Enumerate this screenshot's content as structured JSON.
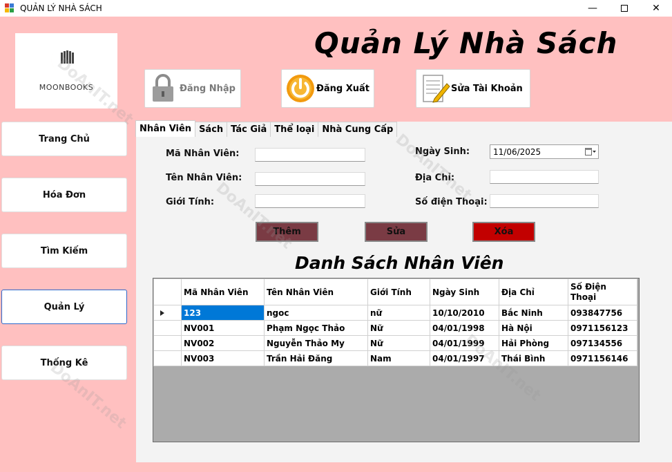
{
  "window": {
    "title": "QUẢN LÝ NHÀ SÁCH"
  },
  "header": {
    "title": "Quản Lý Nhà Sách"
  },
  "logo": {
    "text": "MOONBOOKS"
  },
  "top_buttons": {
    "login": "Đăng Nhập",
    "logout": "Đăng Xuất",
    "edit_account": "Sửa Tài Khoản"
  },
  "sidebar": {
    "items": [
      {
        "label": "Trang Chủ"
      },
      {
        "label": "Hóa Đơn"
      },
      {
        "label": "Tìm Kiếm"
      },
      {
        "label": "Quản Lý"
      },
      {
        "label": "Thống Kê"
      }
    ]
  },
  "tabs": [
    {
      "label": "Nhân Viên"
    },
    {
      "label": "Sách"
    },
    {
      "label": "Tác Giả"
    },
    {
      "label": "Thể loại"
    },
    {
      "label": "Nhà Cung Cấp"
    }
  ],
  "form": {
    "employee_id_label": "Mã Nhân Viên:",
    "employee_name_label": "Tên Nhân Viên:",
    "gender_label": "Giới Tính:",
    "birth_date_label": "Ngày Sinh:",
    "address_label": "Địa Chỉ:",
    "phone_label": "Số điện Thoại:",
    "birth_date_value": "11/06/2025"
  },
  "actions": {
    "add": "Thêm",
    "edit": "Sửa",
    "delete": "Xóa"
  },
  "list": {
    "title": "Danh Sách Nhân Viên",
    "columns": [
      "Mã Nhân Viên",
      "Tên Nhân Viên",
      "Giới Tính",
      "Ngày Sinh",
      "Địa Chỉ",
      "Số Điện Thoại"
    ],
    "rows": [
      [
        "123",
        "ngoc",
        "nữ",
        "10/10/2010",
        "Bắc Ninh",
        "093847756"
      ],
      [
        "NV001",
        "Phạm Ngọc Thảo",
        "Nữ",
        "04/01/1998",
        "Hà Nội",
        "0971156123"
      ],
      [
        "NV002",
        "Nguyễn Thảo My",
        "Nữ",
        "04/01/1999",
        "Hải Phòng",
        "097134556"
      ],
      [
        "NV003",
        "Trần Hải Đăng",
        "Nam",
        "04/01/1997",
        "Thái Bình",
        "0971156146"
      ]
    ]
  },
  "watermark": {
    "text": "DoAnIT.net"
  },
  "colors": {
    "background": "#ffc0c0",
    "add_button": "#7a3b44",
    "delete_button": "#c20000",
    "selection": "#0078d7"
  }
}
